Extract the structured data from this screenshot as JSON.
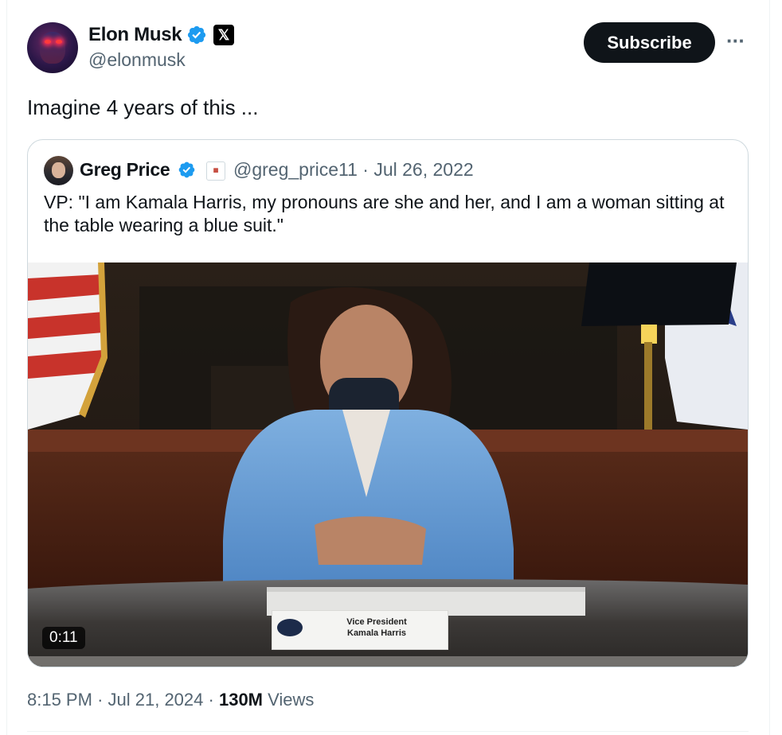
{
  "author": {
    "name": "Elon Musk",
    "handle": "@elonmusk",
    "affiliate_badge_icon": "x-logo-icon",
    "verified_color": "#1d9bf0"
  },
  "actions": {
    "subscribe_label": "Subscribe",
    "more_label": "···"
  },
  "tweet": {
    "text": "Imagine 4 years of this ...",
    "time": "8:15 PM",
    "date": "Jul 21, 2024",
    "views_count": "130M",
    "views_label": "Views"
  },
  "quoted": {
    "name": "Greg Price",
    "handle_date": "@greg_price11 · Jul 26, 2022",
    "text": "VP: \"I am Kamala Harris, my pronouns are she and her, and I am a woman sitting at the table wearing a blue suit.\"",
    "video": {
      "duration": "0:11",
      "nameplate_line1": "Vice President",
      "nameplate_line2": "Kamala Harris"
    }
  }
}
